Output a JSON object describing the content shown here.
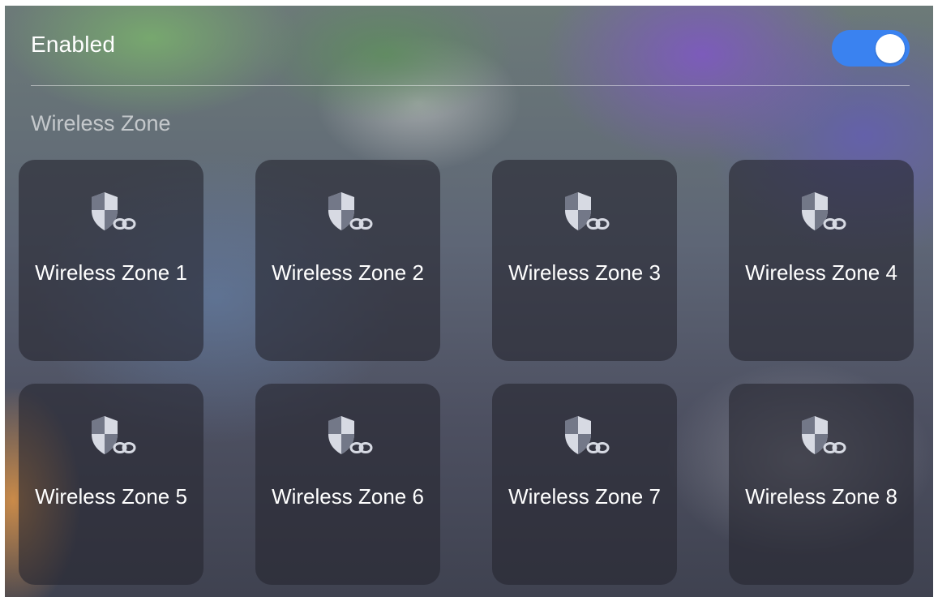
{
  "settings": {
    "enabled_label": "Enabled",
    "enabled": true,
    "toggle_color": "#3a82f0",
    "section_title": "Wireless Zone"
  },
  "zones": [
    {
      "label": "Wireless Zone 1",
      "icon": "shield-link-icon"
    },
    {
      "label": "Wireless Zone 2",
      "icon": "shield-link-icon"
    },
    {
      "label": "Wireless Zone 3",
      "icon": "shield-link-icon"
    },
    {
      "label": "Wireless Zone 4",
      "icon": "shield-link-icon"
    },
    {
      "label": "Wireless Zone 5",
      "icon": "shield-link-icon"
    },
    {
      "label": "Wireless Zone 6",
      "icon": "shield-link-icon"
    },
    {
      "label": "Wireless Zone 7",
      "icon": "shield-link-icon"
    },
    {
      "label": "Wireless Zone 8",
      "icon": "shield-link-icon"
    }
  ]
}
